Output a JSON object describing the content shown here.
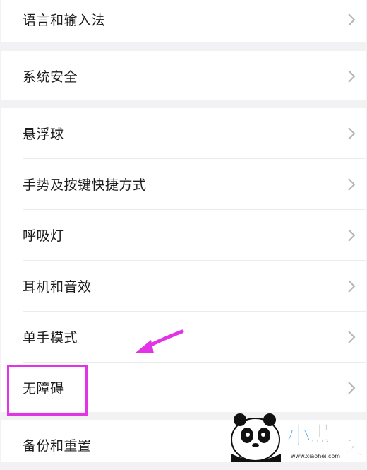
{
  "settings": {
    "language": "语言和输入法",
    "security": "系统安全",
    "floating_ball": "悬浮球",
    "gestures": "手势及按键快捷方式",
    "breathing_light": "呼吸灯",
    "earphones": "耳机和音效",
    "one_hand": "单手模式",
    "accessibility": "无障碍",
    "backup": "备份和重置"
  },
  "watermark": {
    "site": "www.xiaohei.com",
    "brand_text": "小黑游戏"
  },
  "colors": {
    "highlight": "#e233e6",
    "background": "#f2f2f4"
  }
}
